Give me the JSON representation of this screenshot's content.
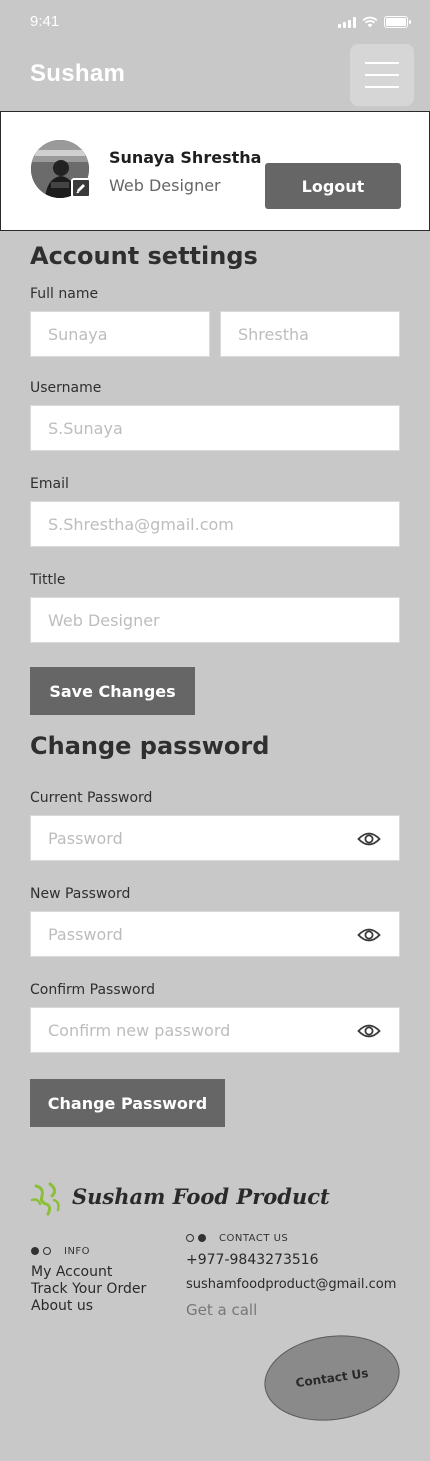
{
  "status_bar": {
    "time": "9:41"
  },
  "header": {
    "title": "Susham"
  },
  "profile": {
    "name": "Sunaya Shrestha",
    "role": "Web Designer",
    "logout_label": "Logout"
  },
  "account": {
    "title": "Account settings",
    "full_name_label": "Full name",
    "first_name_placeholder": "Sunaya",
    "last_name_placeholder": "Shrestha",
    "username_label": "Username",
    "username_placeholder": "S.Sunaya",
    "email_label": "Email",
    "email_placeholder": "S.Shrestha@gmail.com",
    "title_label": "Tittle",
    "title_placeholder": "Web Designer",
    "save_label": "Save Changes"
  },
  "password": {
    "title": "Change password",
    "current_label": "Current Password",
    "current_placeholder": "Password",
    "new_label": "New Password",
    "new_placeholder": "Password",
    "confirm_label": "Confirm Password",
    "confirm_placeholder": "Confirm new password",
    "button_label": "Change Password"
  },
  "footer": {
    "brand": "Susham Food Product",
    "info_heading": "INFO",
    "info_links": [
      "My Account",
      "Track Your Order",
      "About us"
    ],
    "contact_heading": "CONTACT US",
    "phone": "+977-9843273516",
    "email": "sushamfoodproduct@gmail.com",
    "call": "Get a call",
    "contact_button": "Contact Us"
  },
  "icons": {
    "menu": "hamburger-menu-icon",
    "edit": "pencil-icon",
    "eye": "eye-icon",
    "logo": "leaf-logo-icon"
  },
  "colors": {
    "background": "#c8c8c8",
    "button": "#666666",
    "logo_green": "#8bbf3a"
  }
}
